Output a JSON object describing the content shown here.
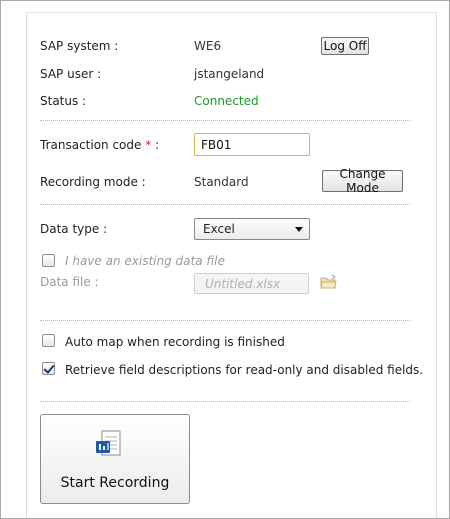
{
  "sap": {
    "system_label": "SAP system :",
    "system_value": "WE6",
    "logoff_label": "Log Off",
    "user_label": "SAP user :",
    "user_value": "jstangeland",
    "status_label": "Status :",
    "status_value": "Connected"
  },
  "transaction": {
    "label": "Transaction code",
    "required_mark": "*",
    "colon": ":",
    "value": "FB01"
  },
  "recording_mode": {
    "label": "Recording mode :",
    "value": "Standard",
    "change_label": "Change Mode"
  },
  "data_type": {
    "label": "Data type :",
    "selected": "Excel"
  },
  "existing_file": {
    "checked": false,
    "label": "I have an existing data file"
  },
  "data_file": {
    "label": "Data file :",
    "placeholder": "Untitled.xlsx"
  },
  "options": {
    "auto_map": {
      "checked": false,
      "label": "Auto map when recording is finished"
    },
    "retrieve_desc": {
      "checked": true,
      "label": "Retrieve field descriptions for read-only and disabled fields."
    }
  },
  "start_button": {
    "label": "Start Recording",
    "icon": "recording-document-icon"
  },
  "colors": {
    "status_connected": "#1a9c2a",
    "required": "#d62020",
    "input_focus_border": "#e2b24a"
  }
}
